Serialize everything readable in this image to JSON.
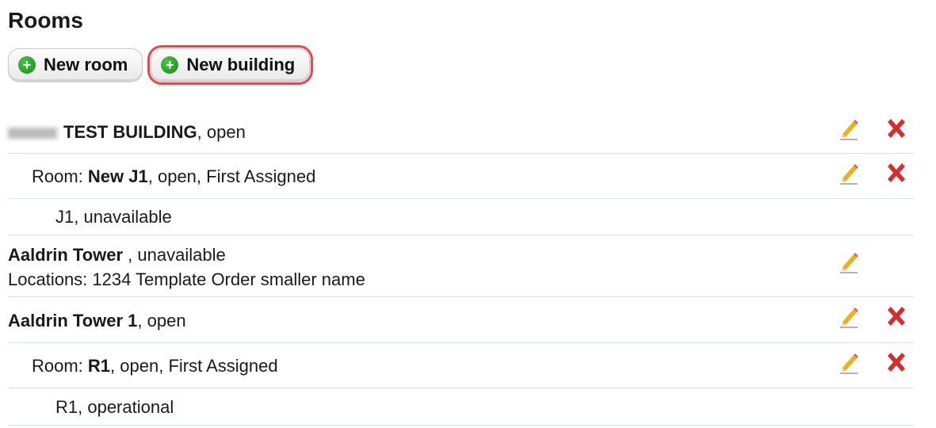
{
  "page": {
    "title": "Rooms"
  },
  "toolbar": {
    "new_room_label": "New room",
    "new_building_label": "New building"
  },
  "rows": [
    {
      "name": "TEST BUILDING",
      "status": ", open"
    },
    {
      "prefix": "Room: ",
      "name": "New J1",
      "status": ", open, First Assigned"
    },
    {
      "text": "J1, unavailable"
    },
    {
      "name": "Aaldrin Tower",
      "status": " , unavailable",
      "locations": "Locations: 1234 Template Order smaller name"
    },
    {
      "name": "Aaldrin Tower 1",
      "status": ", open"
    },
    {
      "prefix": "Room: ",
      "name": "R1",
      "status": ", open, First Assigned"
    },
    {
      "text": "R1, operational"
    }
  ],
  "icons": {
    "edit": "pencil-icon",
    "delete": "red-x-icon",
    "add": "green-plus-icon"
  },
  "colors": {
    "delete": "#d32f2f",
    "add": "#1a9a1a",
    "highlight": "#e5484d",
    "divider": "#d7e3ea"
  }
}
